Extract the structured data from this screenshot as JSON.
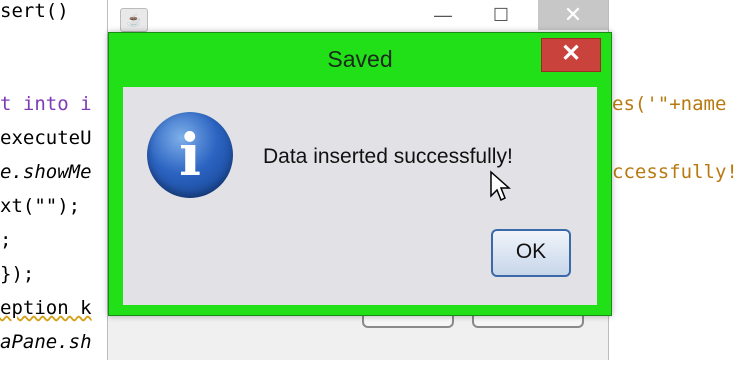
{
  "editor": {
    "lines": [
      "sert()",
      "t into i",
      "executeU",
      "e.showMe",
      "xt(\"\");",
      ";",
      "});",
      "eption k",
      "aPane.sh"
    ],
    "right_fragments": {
      "line1": "es('\"+name",
      "line3": "ccessfully!"
    }
  },
  "parent_window": {
    "icon": "java-icon",
    "minimize_icon": "minimize-icon",
    "maximize_icon": "maximize-icon",
    "close_icon": "close-icon"
  },
  "dialog": {
    "title": "Saved",
    "close_symbol": "✕",
    "message": "Data inserted successfully!",
    "icon": "info-icon",
    "icon_letter": "i",
    "ok_label": "OK",
    "frame_color": "#22e018",
    "close_color": "#c9433c"
  }
}
